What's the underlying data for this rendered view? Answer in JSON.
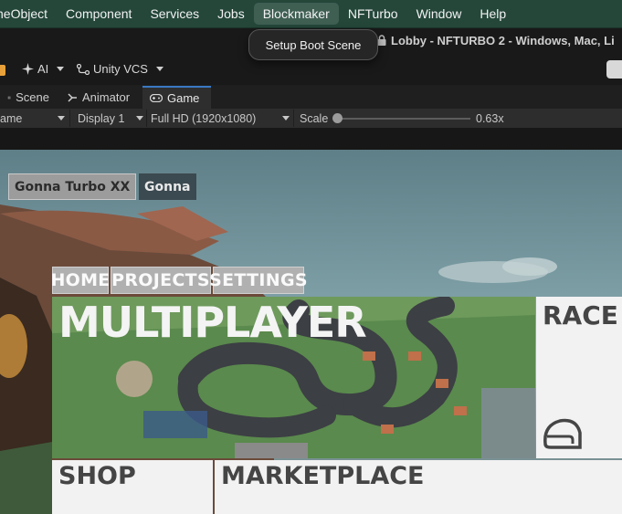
{
  "menubar": {
    "items": [
      "neObject",
      "Component",
      "Services",
      "Jobs",
      "Blockmaker",
      "NFTurbo",
      "Window",
      "Help"
    ],
    "active_index": 4
  },
  "dropdown": {
    "item": "Setup Boot Scene"
  },
  "window": {
    "title": "Lobby - NFTURBO 2 - Windows, Mac, Li"
  },
  "toolbar": {
    "ai_label": "AI",
    "vcs_label": "Unity VCS"
  },
  "tabs": [
    {
      "label": "Scene",
      "icon": "scene-icon"
    },
    {
      "label": "Animator",
      "icon": "animator-icon"
    },
    {
      "label": "Game",
      "icon": "gamepad-icon",
      "active": true
    }
  ],
  "gamebar": {
    "mode": "ame",
    "display": "Display 1",
    "resolution": "Full HD (1920x1080)",
    "scale_label": "Scale",
    "scale_value": "0.63x",
    "scale_fraction": 0.03
  },
  "game": {
    "player_names": [
      "Gonna Turbo XX",
      "Gonna"
    ],
    "nav": [
      "HOME",
      "PROJECTS",
      "SETTINGS"
    ],
    "cards": {
      "multiplayer": "MULTIPLAYER",
      "race": "RACE",
      "shop": "SHOP",
      "marketplace": "MARKETPLACE"
    }
  },
  "colors": {
    "menubar_bg": "#24473a",
    "tab_accent": "#3a79c3",
    "card_bg": "#f2f2f2",
    "nav_bg": "#b0b0b0"
  }
}
